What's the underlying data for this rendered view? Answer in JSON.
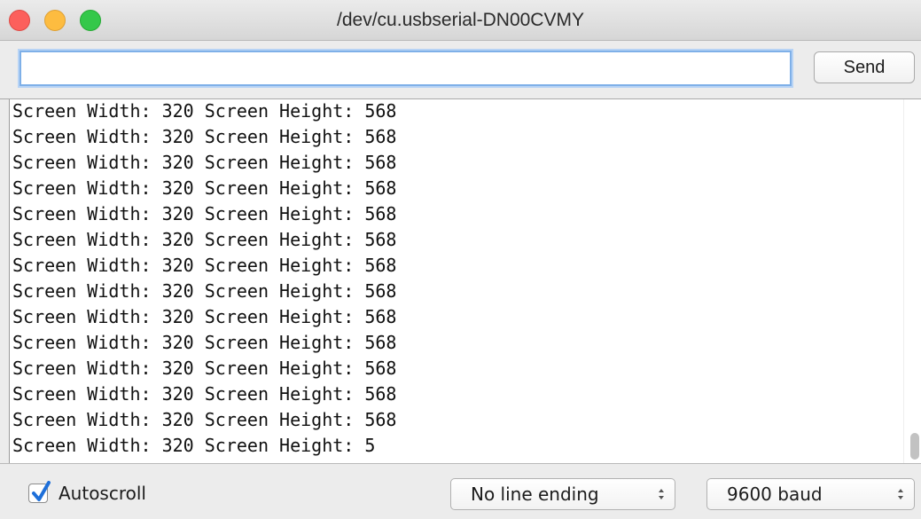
{
  "window": {
    "title": "/dev/cu.usbserial-DN00CVMY"
  },
  "toolbar": {
    "input_value": "",
    "send_label": "Send"
  },
  "output": {
    "lines": [
      "Screen Width: 320 Screen Height: 568",
      "Screen Width: 320 Screen Height: 568",
      "Screen Width: 320 Screen Height: 568",
      "Screen Width: 320 Screen Height: 568",
      "Screen Width: 320 Screen Height: 568",
      "Screen Width: 320 Screen Height: 568",
      "Screen Width: 320 Screen Height: 568",
      "Screen Width: 320 Screen Height: 568",
      "Screen Width: 320 Screen Height: 568",
      "Screen Width: 320 Screen Height: 568",
      "Screen Width: 320 Screen Height: 568",
      "Screen Width: 320 Screen Height: 568",
      "Screen Width: 320 Screen Height: 568",
      "Screen Width: 320 Screen Height: 5"
    ],
    "scroll_position": 1.0
  },
  "bottom": {
    "autoscroll_label": "Autoscroll",
    "autoscroll_checked": true,
    "line_ending": "No line ending",
    "baud_rate": "9600 baud"
  },
  "colors": {
    "close": "#fc605c",
    "minimize": "#fdbc40",
    "zoom": "#34c84a",
    "focus_ring": "#7fb0e8",
    "checkbox_accent": "#1e6fd9"
  },
  "icons": {
    "close": "close-icon",
    "minimize": "minimize-icon",
    "zoom": "zoom-icon",
    "checkmark": "checkmark-icon",
    "select_arrows": "updown-chevron-icon"
  }
}
